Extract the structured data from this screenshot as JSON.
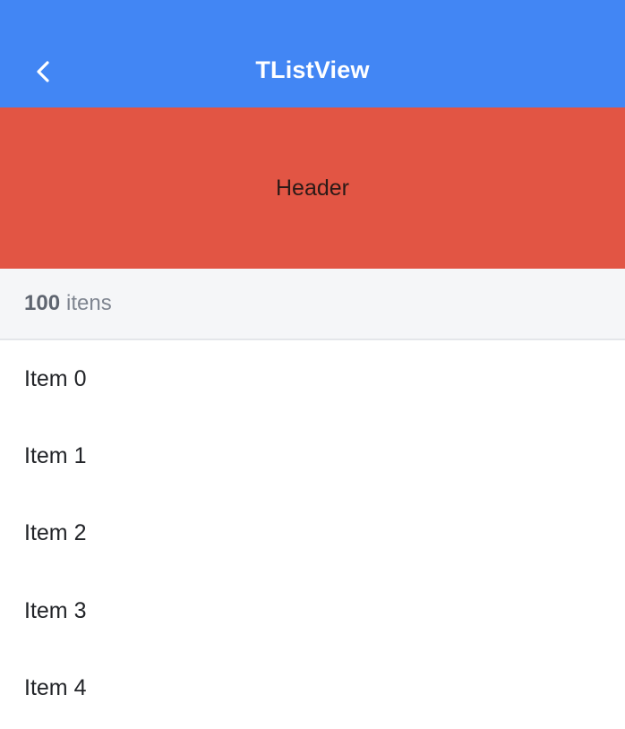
{
  "app_bar": {
    "title": "TListView",
    "back_icon": "chevron-left-icon",
    "background": "#4286f4"
  },
  "header": {
    "label": "Header",
    "background": "#e25544"
  },
  "count_bar": {
    "count": "100",
    "suffix": "itens"
  },
  "list": {
    "items": [
      {
        "label": "Item 0"
      },
      {
        "label": "Item 1"
      },
      {
        "label": "Item 2"
      },
      {
        "label": "Item 3"
      },
      {
        "label": "Item 4"
      }
    ]
  }
}
